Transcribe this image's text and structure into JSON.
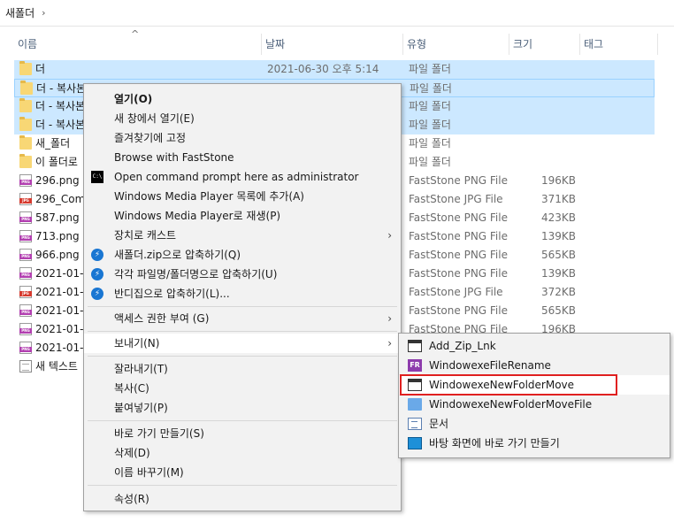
{
  "breadcrumb": {
    "current": "새폴더",
    "separator": "›"
  },
  "columns": {
    "name": "이름",
    "date": "날짜",
    "type": "유형",
    "size": "크기",
    "tags": "태그",
    "sort_arrow": "^"
  },
  "files": [
    {
      "name": "더",
      "date": "2021-06-30 오후 5:14",
      "type": "파일 폴더",
      "size": "",
      "icon": "folder-icon",
      "selected": true
    },
    {
      "name": "더 - 복사본",
      "date": "",
      "type": "파일 폴더",
      "size": "",
      "icon": "folder-icon",
      "selected": true
    },
    {
      "name": "더 - 복사본",
      "date": "",
      "type": "파일 폴더",
      "size": "",
      "icon": "folder-icon",
      "selected": true
    },
    {
      "name": "더 - 복사본",
      "date": "",
      "type": "파일 폴더",
      "size": "",
      "icon": "folder-icon",
      "selected": true
    },
    {
      "name": "새_폴더",
      "date": "",
      "type": "파일 폴더",
      "size": "",
      "icon": "folder-icon",
      "selected": false
    },
    {
      "name": "이 폴더로",
      "date": "",
      "type": "파일 폴더",
      "size": "",
      "icon": "folder-icon",
      "selected": false
    },
    {
      "name": "296.png",
      "date": "",
      "type": "FastStone PNG File",
      "size": "196KB",
      "icon": "png-icon",
      "selected": false
    },
    {
      "name": "296_Comb",
      "date": "",
      "type": "FastStone JPG File",
      "size": "371KB",
      "icon": "jpg-icon",
      "selected": false
    },
    {
      "name": "587.png",
      "date": "",
      "type": "FastStone PNG File",
      "size": "423KB",
      "icon": "png-icon",
      "selected": false
    },
    {
      "name": "713.png",
      "date": "",
      "type": "FastStone PNG File",
      "size": "139KB",
      "icon": "png-icon",
      "selected": false
    },
    {
      "name": "966.png",
      "date": "",
      "type": "FastStone PNG File",
      "size": "565KB",
      "icon": "png-icon",
      "selected": false
    },
    {
      "name": "2021-01-2",
      "date": "",
      "type": "FastStone PNG File",
      "size": "139KB",
      "icon": "png-icon",
      "selected": false
    },
    {
      "name": "2021-01-2",
      "date": "",
      "type": "FastStone JPG File",
      "size": "372KB",
      "icon": "jpg-icon",
      "selected": false
    },
    {
      "name": "2021-01-2",
      "date": "",
      "type": "FastStone PNG File",
      "size": "565KB",
      "icon": "png-icon",
      "selected": false
    },
    {
      "name": "2021-01-2",
      "date": "",
      "type": "FastStone PNG File",
      "size": "196KB",
      "icon": "png-icon",
      "selected": false
    },
    {
      "name": "2021-01-2",
      "date": "",
      "type": "",
      "size": "",
      "icon": "png-icon",
      "selected": false
    },
    {
      "name": "새 텍스트",
      "date": "",
      "type": "",
      "size": "",
      "icon": "text-file-icon",
      "selected": false
    }
  ],
  "context_menu": {
    "open": "열기(O)",
    "open_new_window": "새 창에서 열기(E)",
    "pin_quick_access": "즐겨찾기에 고정",
    "browse_faststone": "Browse with FastStone",
    "open_cmd_admin": "Open command prompt here as administrator",
    "wmp_add_list": "Windows Media Player 목록에 추가(A)",
    "wmp_play": "Windows Media Player로 재생(P)",
    "cast_device": "장치로 캐스트",
    "zip_compress": "새폴더.zip으로 압축하기(Q)",
    "zip_each": "각각 파일명/폴더명으로 압축하기(U)",
    "bandizip_compress": "반디집으로 압축하기(L)...",
    "access_grant": "액세스 권한 부여 (G)",
    "send_to": "보내기(N)",
    "cut": "잘라내기(T)",
    "copy": "복사(C)",
    "paste": "붙여넣기(P)",
    "create_shortcut": "바로 가기 만들기(S)",
    "delete": "삭제(D)",
    "rename": "이름 바꾸기(M)",
    "properties": "속성(R)",
    "arrow": "›"
  },
  "send_to_menu": {
    "add_zip_lnk": "Add_Zip_Lnk",
    "file_rename": "WindowexeFileRename",
    "fr_badge": "FR",
    "new_folder_move": "WindowexeNewFolderMove",
    "new_folder_move_file": "WindowexeNewFolderMoveFile",
    "documents": "문서",
    "desktop_shortcut": "바탕 화면에 바로 가기 만들기"
  },
  "colors": {
    "selection": "#cce8ff",
    "menu_bg": "#f2f2f2",
    "highlight_box": "#e02020"
  }
}
